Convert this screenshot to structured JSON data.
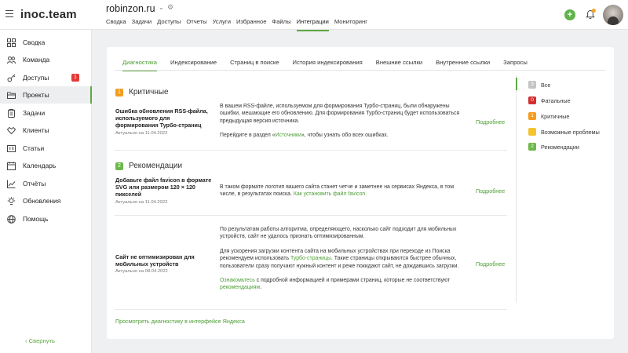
{
  "header": {
    "logo_text": "inoc.team",
    "site_name": "robinzon.ru",
    "nav": [
      {
        "label": "Сводка"
      },
      {
        "label": "Задачи"
      },
      {
        "label": "Доступы"
      },
      {
        "label": "Отчеты"
      },
      {
        "label": "Услуги"
      },
      {
        "label": "Избранное"
      },
      {
        "label": "Файлы"
      },
      {
        "label": "Интеграции"
      },
      {
        "label": "Мониторинг"
      }
    ],
    "active_nav": "Интеграции",
    "add_label": "+",
    "colors": {
      "accent": "#5fa843",
      "add_button": "#5fb34a",
      "notification_dot": "#f5a623"
    }
  },
  "sidebar": {
    "items": [
      {
        "label": "Сводка",
        "icon": "dashboard-icon"
      },
      {
        "label": "Команда",
        "icon": "team-icon"
      },
      {
        "label": "Доступы",
        "icon": "key-icon",
        "badge": "1"
      },
      {
        "label": "Проекты",
        "icon": "folder-icon"
      },
      {
        "label": "Задачи",
        "icon": "tasks-icon"
      },
      {
        "label": "Клиенты",
        "icon": "clients-icon"
      },
      {
        "label": "Статьи",
        "icon": "articles-icon"
      },
      {
        "label": "Календарь",
        "icon": "calendar-icon"
      },
      {
        "label": "Отчёты",
        "icon": "reports-icon"
      },
      {
        "label": "Обновления",
        "icon": "updates-icon"
      },
      {
        "label": "Помощь",
        "icon": "help-icon"
      }
    ],
    "active_item": "Проекты",
    "collapse_label": "Свернуть"
  },
  "main": {
    "tabs": [
      {
        "label": "Диагностика"
      },
      {
        "label": "Индексирование"
      },
      {
        "label": "Страниц в поиске"
      },
      {
        "label": "История индексирования"
      },
      {
        "label": "Внешние ссылки"
      },
      {
        "label": "Внутренние ссылки"
      },
      {
        "label": "Запросы"
      }
    ],
    "active_tab": "Диагностика",
    "sections": [
      {
        "badge": "1",
        "badge_color": "#f39c1f",
        "title": "Критичные",
        "rows": [
          {
            "title": "Ошибка обновления RSS-файла, используемого для формирования Турбо-страниц",
            "date": "Актуально на 11.04.2022",
            "text_1": "В вашем RSS-файле, используемом для формирования Турбо-страниц, были обнаружены ошибки, мешающие его обновлению. Для формирования Турбо-страниц будет использоваться предыдущая версия источника.",
            "text_2_before": "Перейдите в раздел «",
            "text_2_link": "Источники",
            "text_2_after": "», чтобы узнать обо всех ошибках.",
            "more": "Подробнее"
          }
        ]
      },
      {
        "badge": "2",
        "badge_color": "#6cb84a",
        "title": "Рекомендации",
        "rows": [
          {
            "title": "Добавьте файл favicon в формате SVG или размером 120 × 120 пикселей",
            "date": "Актуально на 11.04.2022",
            "text_1": "В таком формате логотип вашего сайта станет четче и заметнее на сервисах Яндекса, в том числе, в результатах поиска.",
            "text_1_link": "Как установить файл favicon.",
            "more": "Подробнее"
          },
          {
            "title": "Сайт не оптимизирован для мобильных устройств",
            "date": "Актуально на 08.04.2022",
            "text_1": "По результатам работы алгоритма, определяющего, насколько сайт подходит для мобильных устройств, сайт не удалось признать оптимизированным.",
            "text_2_before": "Для ускорения загрузки контента сайта на мобильных устройствах при переходе из Поиска рекомендуем использовать",
            "text_2_link": "Турбо-страницы",
            "text_2_after": ". Такие страницы открываются быстрее обычных, пользователи сразу получают нужный контент и реже покидают сайт, не дождавшись загрузки.",
            "text_3_link": "Ознакомьтесь",
            "text_3_mid": "с подробной информацией и примерами страниц, которые не соответствуют",
            "text_3_link2": "рекомендациям",
            "text_3_end": ".",
            "more": "Подробнее"
          }
        ]
      }
    ],
    "filters": [
      {
        "badge": "3",
        "label": "Все",
        "color": "#c4c4c4"
      },
      {
        "badge": "0",
        "label": "Фатальные",
        "color": "#d32f2f"
      },
      {
        "badge": "1",
        "label": "Критичные",
        "color": "#f39c1f"
      },
      {
        "badge": "",
        "label": "Возможные проблемы",
        "color": "#f4c430"
      },
      {
        "badge": "2",
        "label": "Рекомендации",
        "color": "#6cb84a"
      }
    ],
    "active_filter": "Все",
    "yandex_link": "Просмотреть диагностику в интерфейсе Яндекса"
  }
}
